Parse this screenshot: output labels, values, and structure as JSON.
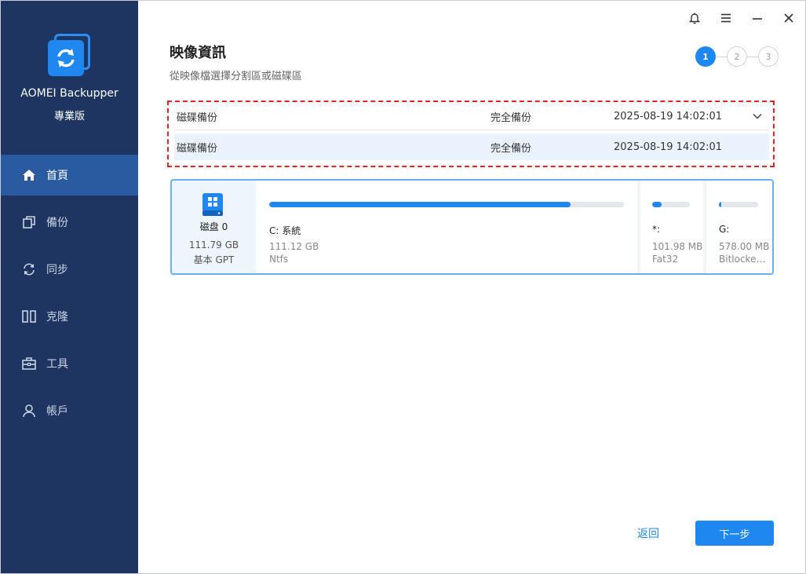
{
  "app": {
    "name": "AOMEI Backupper",
    "edition": "專業版"
  },
  "sidebar": {
    "items": [
      {
        "label": "首頁",
        "icon": "home-icon"
      },
      {
        "label": "備份",
        "icon": "backup-icon"
      },
      {
        "label": "同步",
        "icon": "sync-icon"
      },
      {
        "label": "克隆",
        "icon": "clone-icon"
      },
      {
        "label": "工具",
        "icon": "tools-icon"
      },
      {
        "label": "帳戶",
        "icon": "account-icon"
      }
    ]
  },
  "titlebar": {
    "icons": [
      "bell-icon",
      "menu-icon",
      "minimize-icon",
      "close-icon"
    ]
  },
  "page": {
    "title": "映像資訊",
    "subtitle": "從映像檔選擇分割區或磁碟區"
  },
  "steps": [
    "1",
    "2",
    "3"
  ],
  "backups": {
    "selected": {
      "name": "磁碟備份",
      "type": "完全備份",
      "time": "2025-08-19 14:02:01"
    },
    "options": [
      {
        "name": "磁碟備份",
        "type": "完全備份",
        "time": "2025-08-19 14:02:01"
      }
    ]
  },
  "disk": {
    "name": "磁盘 0",
    "size": "111.79 GB",
    "type": "基本 GPT",
    "partitions": [
      {
        "label": "C: 系統",
        "size": "111.12 GB",
        "fs": "Ntfs",
        "used_fraction": 0.85
      },
      {
        "label": "*:",
        "size": "101.98 MB",
        "fs": "Fat32",
        "used_fraction": 0.25
      },
      {
        "label": "G:",
        "size": "578.00 MB",
        "fs": "Bitlocker ...",
        "used_fraction": 0.06
      }
    ]
  },
  "footer": {
    "back_label": "返回",
    "next_label": "下一步"
  },
  "colors": {
    "accent": "#1e88f0",
    "sidebar_bg": "#1d3560",
    "sidebar_active": "#2a5aa0",
    "highlight_border": "#e0262a"
  }
}
